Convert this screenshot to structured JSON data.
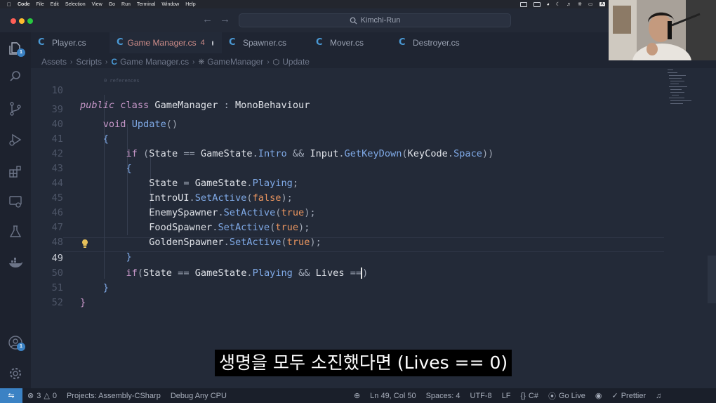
{
  "menubar": {
    "app": "Code",
    "items": [
      "File",
      "Edit",
      "Selection",
      "View",
      "Go",
      "Run",
      "Terminal",
      "Window",
      "Help"
    ],
    "input_indicator": "A"
  },
  "titlebar": {
    "search_text": "Kimchi-Run",
    "back_icon": "arrow-left-icon",
    "forward_icon": "arrow-right-icon"
  },
  "activity": {
    "explorer_badge": "1",
    "accounts_badge": "1"
  },
  "tabs": [
    {
      "label": "Player.cs",
      "active": false
    },
    {
      "label": "Game Manager.cs",
      "active": true,
      "problems": "4",
      "modified": true
    },
    {
      "label": "Spawner.cs",
      "active": false
    },
    {
      "label": "Mover.cs",
      "active": false
    },
    {
      "label": "Destroyer.cs",
      "active": false
    }
  ],
  "breadcrumbs": [
    "Assets",
    "Scripts",
    "Game Manager.cs",
    "GameManager",
    "Update"
  ],
  "editor": {
    "refhint": "0 references",
    "line_numbers": [
      "10",
      "39",
      "40",
      "41",
      "42",
      "43",
      "44",
      "45",
      "46",
      "47",
      "48",
      "49",
      "50",
      "51",
      "52"
    ],
    "current_line": "49"
  },
  "subtitle": "생명을 모두 소진했다면 (Lives == 0)",
  "statusbar": {
    "errors": "3",
    "warnings": "0",
    "projects": "Projects: Assembly-CSharp",
    "debug": "Debug Any CPU",
    "position": "Ln 49, Col 50",
    "spaces": "Spaces: 4",
    "encoding": "UTF-8",
    "eol": "LF",
    "language": "C#",
    "golive": "Go Live",
    "prettier": "Prettier"
  },
  "colors": {
    "accent": "#3b82c4",
    "editor_bg": "#232a38",
    "keyword": "#c596c7",
    "function": "#7fa9e6",
    "boolean": "#e8945f"
  }
}
